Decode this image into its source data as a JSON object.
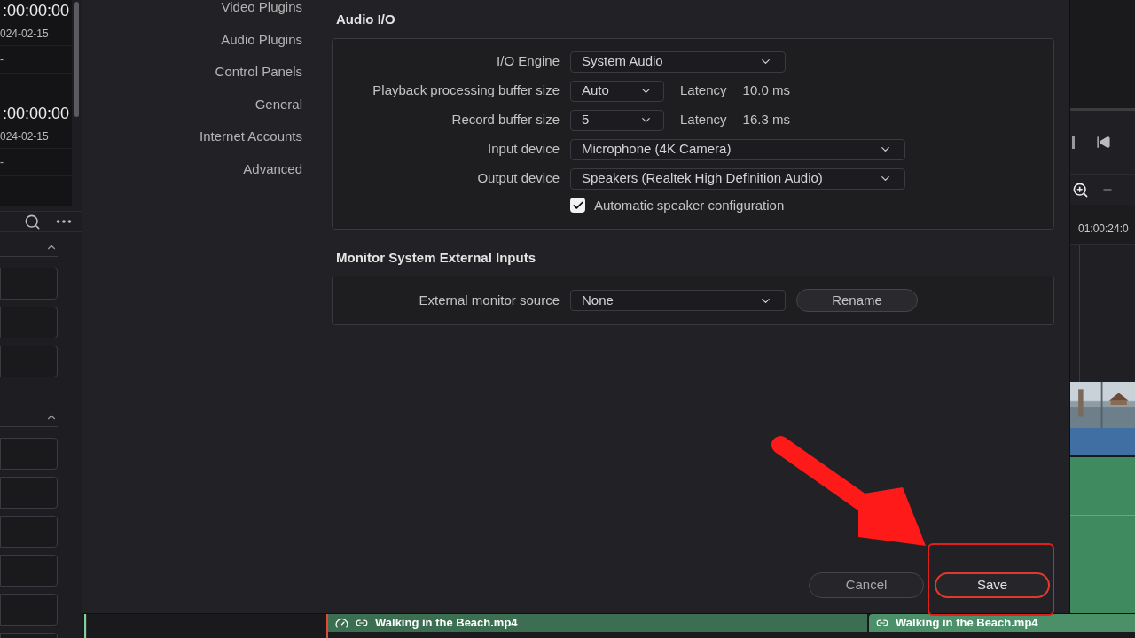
{
  "left_panel": {
    "clips": [
      {
        "timecode": ":00:00:00",
        "date": "024-02-15",
        "column_3": "-"
      },
      {
        "timecode": ":00:00:00",
        "date": "024-02-15",
        "column_3": "-"
      }
    ],
    "sections": [
      {
        "expanded": true
      },
      {
        "expanded": true
      }
    ]
  },
  "sidebar": {
    "items": [
      {
        "label": "Video Plugins",
        "selected": false
      },
      {
        "label": "Audio Plugins",
        "selected": false
      },
      {
        "label": "Control Panels",
        "selected": false
      },
      {
        "label": "General",
        "selected": false
      },
      {
        "label": "Internet Accounts",
        "selected": false
      },
      {
        "label": "Advanced",
        "selected": false
      }
    ]
  },
  "audio_io": {
    "title": "Audio I/O",
    "rows": [
      {
        "kind": "select",
        "label": "I/O Engine",
        "value": "System Audio"
      },
      {
        "kind": "latency",
        "label": "Playback processing buffer size",
        "value": "Auto",
        "latency_label": "Latency",
        "latency": "10.0 ms"
      },
      {
        "kind": "latency",
        "label": "Record buffer size",
        "value": "5",
        "latency_label": "Latency",
        "latency": "16.3 ms"
      },
      {
        "kind": "select",
        "label": "Input device",
        "value": "Microphone (4K Camera)"
      },
      {
        "kind": "select",
        "label": "Output device",
        "value": "Speakers (Realtek High Definition Audio)"
      },
      {
        "kind": "checkbox",
        "label": "Automatic speaker configuration",
        "checked": true
      }
    ]
  },
  "monitor": {
    "title": "Monitor System External Inputs",
    "label": "External monitor source",
    "value": "None",
    "button": "Rename"
  },
  "buttons": [
    {
      "label": "Cancel",
      "highlighted": false
    },
    {
      "label": "Save",
      "highlighted": true
    }
  ],
  "timeline": {
    "timecode": "01:00:24:0",
    "clips": [
      {
        "label": "Walking in the Beach.mp4",
        "speed_icon": true
      },
      {
        "label": "Walking in the Beach.mp4",
        "speed_icon": false
      }
    ]
  }
}
